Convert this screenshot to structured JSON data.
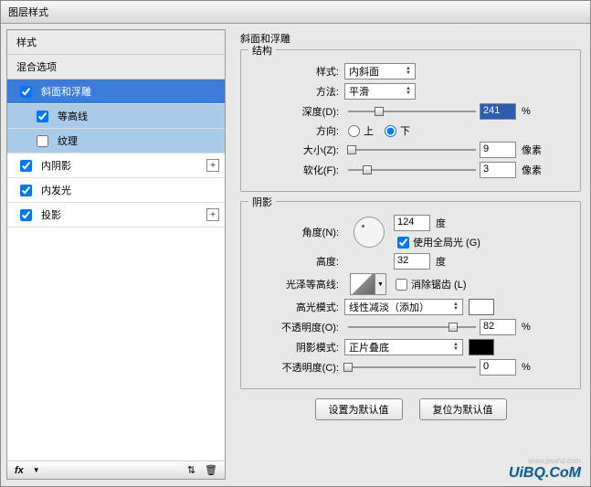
{
  "title": "图层样式",
  "sidebar": {
    "head1": "样式",
    "head2": "混合选项",
    "items": [
      {
        "label": "斜面和浮雕",
        "checked": true,
        "selected": true
      },
      {
        "label": "等高线",
        "checked": true,
        "sub": true
      },
      {
        "label": "纹理",
        "checked": false,
        "sub": true
      },
      {
        "label": "内阴影",
        "checked": true,
        "plus": true
      },
      {
        "label": "内发光",
        "checked": true
      },
      {
        "label": "投影",
        "checked": true,
        "plus": true
      }
    ],
    "fx": "fx"
  },
  "main": {
    "section_label": "斜面和浮雕",
    "structure": {
      "legend": "结构",
      "style_label": "样式:",
      "style_value": "内斜面",
      "method_label": "方法:",
      "method_value": "平滑",
      "depth_label": "深度(D):",
      "depth_value": "241",
      "depth_unit": "%",
      "direction_label": "方向:",
      "dir_up": "上",
      "dir_down": "下",
      "size_label": "大小(Z):",
      "size_value": "9",
      "size_unit": "像素",
      "soften_label": "软化(F):",
      "soften_value": "3",
      "soften_unit": "像素"
    },
    "shade": {
      "legend": "阴影",
      "angle_label": "角度(N):",
      "angle_value": "124",
      "angle_unit": "度",
      "global_label": "使用全局光 (G)",
      "altitude_label": "高度:",
      "altitude_value": "32",
      "altitude_unit": "度",
      "gloss_label": "光泽等高线:",
      "antialias_label": "消除锯齿 (L)",
      "highlight_mode_label": "高光模式:",
      "highlight_mode_value": "线性减淡（添加）",
      "opacity_label": "不透明度(O):",
      "opacity_value": "82",
      "opacity_unit": "%",
      "shadow_mode_label": "阴影模式:",
      "shadow_mode_value": "正片叠底",
      "opacity2_label": "不透明度(C):",
      "opacity2_value": "0",
      "opacity2_unit": "%"
    },
    "buttons": {
      "default": "设置为默认值",
      "reset": "复位为默认值"
    }
  },
  "watermark": "UiBQ.CoM",
  "watermark2": "www.psahz.com"
}
